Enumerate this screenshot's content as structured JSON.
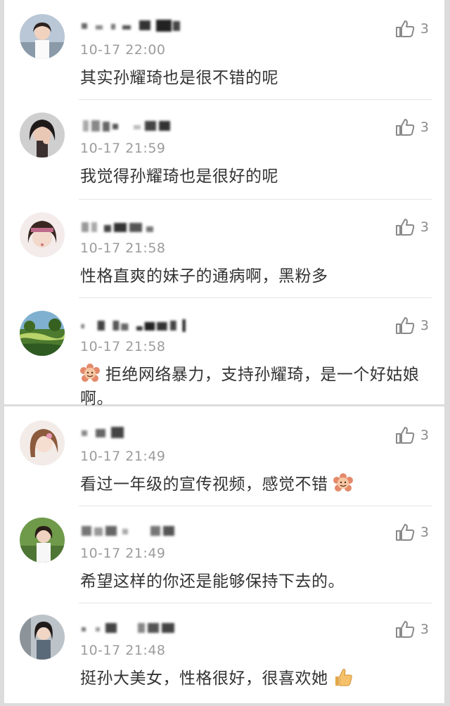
{
  "comments": [
    {
      "time": "10-17 22:00",
      "text": "其实孙耀琦也是很不错的呢",
      "likes": "3",
      "avatar": "avatar-girl-city"
    },
    {
      "time": "10-17 21:59",
      "text": "我觉得孙耀琦也是很好的呢",
      "likes": "3",
      "avatar": "avatar-girl-hand"
    },
    {
      "time": "10-17 21:58",
      "text": "性格直爽的妹子的通病啊，黑粉多",
      "likes": "3",
      "avatar": "avatar-girl-pout"
    },
    {
      "time": "10-17 21:58",
      "text": "拒绝网络暴力，支持孙耀琦，是一个好姑娘啊。",
      "likes": "3",
      "avatar": "avatar-landscape"
    },
    {
      "time": "10-17 21:49",
      "text": "看过一年级的宣传视频，感觉不错",
      "likes": "3",
      "avatar": "avatar-girl-brown"
    },
    {
      "time": "10-17 21:49",
      "text": "希望这样的你还是能够保持下去的。",
      "likes": "3",
      "avatar": "avatar-girl-outdoor"
    },
    {
      "time": "10-17 21:48",
      "text": "挺孙大美女，性格很好，很喜欢她",
      "likes": "3",
      "avatar": "avatar-girl-street"
    }
  ],
  "icons": {
    "like": "thumbs-up-icon",
    "emoji_flower": "flower-face-emoji",
    "emoji_thumb": "thumbs-up-emoji"
  }
}
